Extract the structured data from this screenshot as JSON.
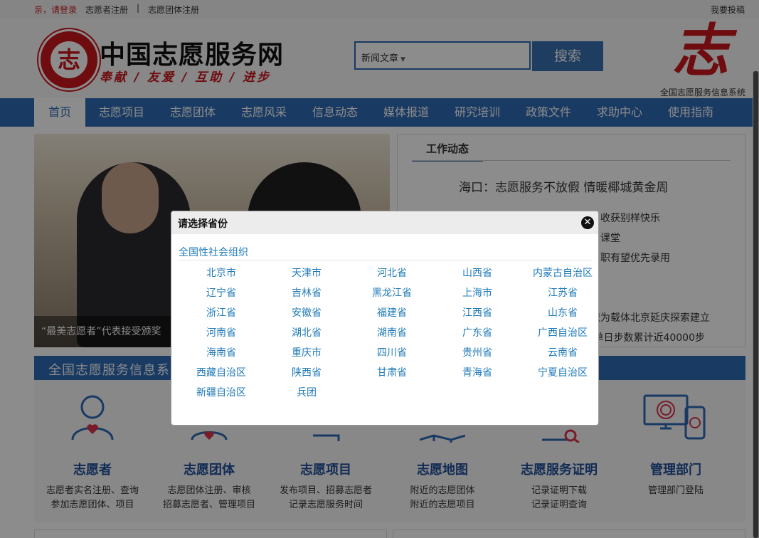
{
  "topbar": {
    "login": "亲，请登录",
    "register_volunteer": "志愿者注册",
    "separator": "|",
    "register_group": "志愿团体注册",
    "submit": "我要投稿"
  },
  "header": {
    "logo_seal_char": "志",
    "logo_title": "中国志愿服务网",
    "slogan": "奉献 / 友爱 / 互助 / 进步",
    "search_select": "新闻文章",
    "search_button": "搜索",
    "zhi_char": "志",
    "system_caption": "全国志愿服务信息系统"
  },
  "nav": [
    "首页",
    "志愿项目",
    "志愿团体",
    "志愿风采",
    "信息动态",
    "媒体报道",
    "研究培训",
    "政策文件",
    "求助中心",
    "使用指南"
  ],
  "banner": {
    "caption": "“最美志愿者”代表接受颁奖"
  },
  "news": {
    "tab": "工作动态",
    "headline": "海口：志愿服务不放假  情暖椰城黄金周",
    "lines": [
      "收获别样快乐",
      "课堂",
      "职有望优先录用",
      "组织为载体北京延庆探索建立",
      "最 单日步数累计近40000步"
    ]
  },
  "system_bar": {
    "title": "全国志愿服务信息系"
  },
  "features": [
    {
      "title": "志愿者",
      "desc1": "志愿者实名注册、查询",
      "desc2": "参加志愿团体、项目"
    },
    {
      "title": "志愿团体",
      "desc1": "志愿团体注册、审核",
      "desc2": "招募志愿者、管理项目"
    },
    {
      "title": "志愿项目",
      "desc1": "发布项目、招募志愿者",
      "desc2": "记录志愿服务时间"
    },
    {
      "title": "志愿地图",
      "desc1": "附近的志愿团体",
      "desc2": "附近的志愿项目"
    },
    {
      "title": "志愿服务证明",
      "desc1": "记录证明下载",
      "desc2": "记录证明查询"
    },
    {
      "title": "管理部门",
      "desc1": "管理部门登陆",
      "desc2": ""
    }
  ],
  "modal": {
    "title": "请选择省份",
    "close_icon": "close-icon",
    "national": "全国性社会组织",
    "provinces": [
      "北京市",
      "天津市",
      "河北省",
      "山西省",
      "内蒙古自治区",
      "辽宁省",
      "吉林省",
      "黑龙江省",
      "上海市",
      "江苏省",
      "浙江省",
      "安徽省",
      "福建省",
      "江西省",
      "山东省",
      "河南省",
      "湖北省",
      "湖南省",
      "广东省",
      "广西自治区",
      "海南省",
      "重庆市",
      "四川省",
      "贵州省",
      "云南省",
      "西藏自治区",
      "陕西省",
      "甘肃省",
      "青海省",
      "宁夏自治区",
      "新疆自治区",
      "兵团"
    ]
  },
  "colors": {
    "brand_blue": "#2f6ab5",
    "brand_red": "#c8161d",
    "link_blue": "#1f7ab8"
  }
}
